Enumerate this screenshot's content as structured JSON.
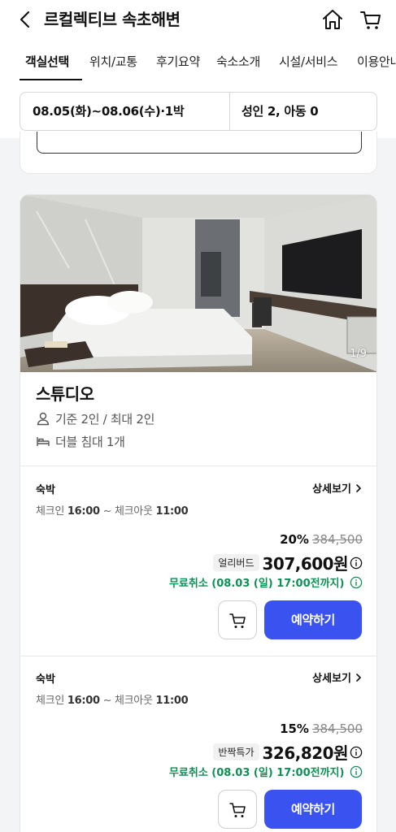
{
  "header": {
    "title": "르컬렉티브 속초해변",
    "back_icon": "chevron-left-icon",
    "home_icon": "home-icon",
    "cart_icon": "cart-icon"
  },
  "tabs": [
    {
      "label": "객실선택",
      "active": true
    },
    {
      "label": "위치/교통"
    },
    {
      "label": "후기요약"
    },
    {
      "label": "숙소소개"
    },
    {
      "label": "시설/서비스"
    },
    {
      "label": "이용안내"
    }
  ],
  "search": {
    "dates": "08.05(화)~08.06(수)·1박",
    "guests": "성인 2, 아동 0"
  },
  "room": {
    "name": "스튜디오",
    "photo_counter": "1/9",
    "capacity": "기준 2인 / 최대 2인",
    "bed": "더블 침대 1개",
    "offers": [
      {
        "type": "숙박",
        "detail_label": "상세보기",
        "checkin_label": "체크인",
        "checkin_time": "16:00",
        "checkout_label": "~ 체크아웃",
        "checkout_time": "11:00",
        "discount": "20%",
        "original_price": "384,500",
        "badge": "얼리버드",
        "price": "307,600원",
        "free_cancel": "무료취소 (08.03 (일) 17:00전까지)",
        "reserve_label": "예약하기"
      },
      {
        "type": "숙박",
        "detail_label": "상세보기",
        "checkin_label": "체크인",
        "checkin_time": "16:00",
        "checkout_label": "~ 체크아웃",
        "checkout_time": "11:00",
        "discount": "15%",
        "original_price": "384,500",
        "badge": "반짝특가",
        "price": "326,820원",
        "free_cancel": "무료취소 (08.03 (일) 17:00전까지)",
        "reserve_label": "예약하기"
      }
    ]
  },
  "colors": {
    "accent": "#3a53f0",
    "cancel_green": "#0f8f56"
  }
}
